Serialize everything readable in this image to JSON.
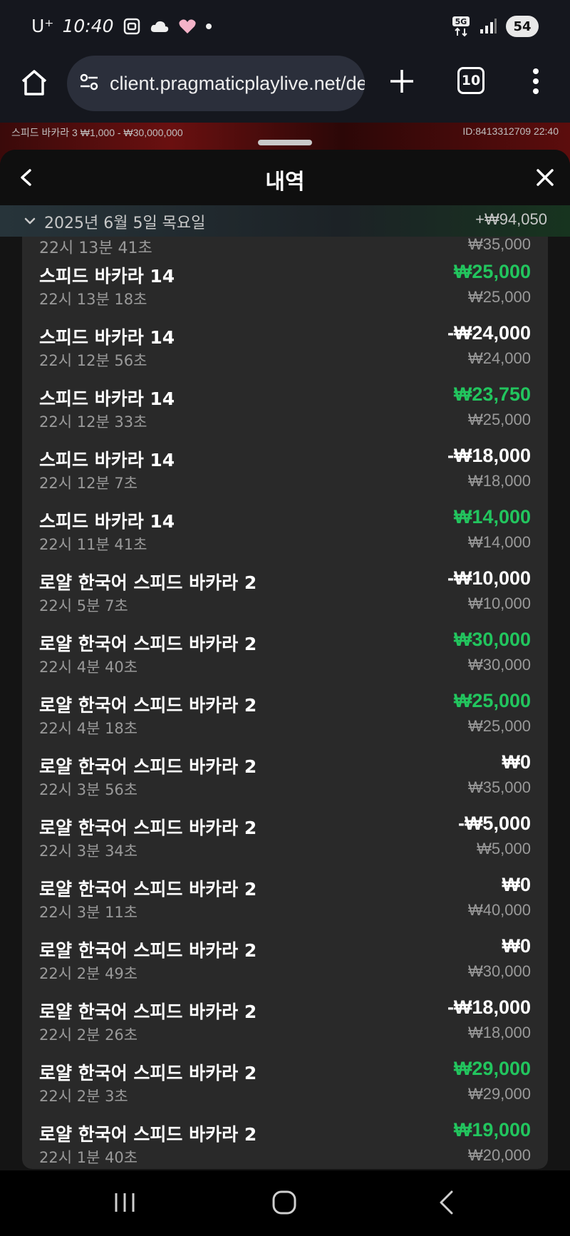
{
  "status_bar": {
    "carrier": "U⁺",
    "time": "10:40",
    "network": "5G",
    "battery": "54"
  },
  "browser": {
    "url": "client.pragmaticplaylive.net/de",
    "tab_count": "10"
  },
  "game_strip": {
    "table_info": "스피드 바카라 3  ₩1,000 - ₩30,000,000",
    "id_time": "ID:8413312709   22:40"
  },
  "sheet": {
    "title": "내역",
    "date_label": "2025년 6월 5일 목요일",
    "date_total": "+₩94,050",
    "partial_row": {
      "time": "22시 13분 41초",
      "bet": "₩35,000"
    },
    "rows": [
      {
        "name": "스피드 바카라 14",
        "time": "22시 13분 18초",
        "amount": "₩25,000",
        "result": "win",
        "bet": "₩25,000"
      },
      {
        "name": "스피드 바카라 14",
        "time": "22시 12분 56초",
        "amount": "-₩24,000",
        "result": "loss",
        "bet": "₩24,000"
      },
      {
        "name": "스피드 바카라 14",
        "time": "22시 12분 33초",
        "amount": "₩23,750",
        "result": "win",
        "bet": "₩25,000"
      },
      {
        "name": "스피드 바카라 14",
        "time": "22시 12분 7초",
        "amount": "-₩18,000",
        "result": "loss",
        "bet": "₩18,000"
      },
      {
        "name": "스피드 바카라 14",
        "time": "22시 11분 41초",
        "amount": "₩14,000",
        "result": "win",
        "bet": "₩14,000"
      },
      {
        "name": "로얄 한국어 스피드 바카라 2",
        "time": "22시 5분 7초",
        "amount": "-₩10,000",
        "result": "loss",
        "bet": "₩10,000"
      },
      {
        "name": "로얄 한국어 스피드 바카라 2",
        "time": "22시 4분 40초",
        "amount": "₩30,000",
        "result": "win",
        "bet": "₩30,000"
      },
      {
        "name": "로얄 한국어 스피드 바카라 2",
        "time": "22시 4분 18초",
        "amount": "₩25,000",
        "result": "win",
        "bet": "₩25,000"
      },
      {
        "name": "로얄 한국어 스피드 바카라 2",
        "time": "22시 3분 56초",
        "amount": "₩0",
        "result": "neutral",
        "bet": "₩35,000"
      },
      {
        "name": "로얄 한국어 스피드 바카라 2",
        "time": "22시 3분 34초",
        "amount": "-₩5,000",
        "result": "loss",
        "bet": "₩5,000"
      },
      {
        "name": "로얄 한국어 스피드 바카라 2",
        "time": "22시 3분 11초",
        "amount": "₩0",
        "result": "neutral",
        "bet": "₩40,000"
      },
      {
        "name": "로얄 한국어 스피드 바카라 2",
        "time": "22시 2분 49초",
        "amount": "₩0",
        "result": "neutral",
        "bet": "₩30,000"
      },
      {
        "name": "로얄 한국어 스피드 바카라 2",
        "time": "22시 2분 26초",
        "amount": "-₩18,000",
        "result": "loss",
        "bet": "₩18,000"
      },
      {
        "name": "로얄 한국어 스피드 바카라 2",
        "time": "22시 2분 3초",
        "amount": "₩29,000",
        "result": "win",
        "bet": "₩29,000"
      },
      {
        "name": "로얄 한국어 스피드 바카라 2",
        "time": "22시 1분 40초",
        "amount": "₩19,000",
        "result": "win",
        "bet": "₩20,000"
      }
    ]
  },
  "colors": {
    "win": "#22c55e",
    "loss": "#ffffff",
    "card_bg": "#292929"
  },
  "icons": {
    "home": "home-icon",
    "site_settings": "tune-icon",
    "new_tab": "plus-icon",
    "tabs": "tab-switcher-icon",
    "menu": "more-vert-icon",
    "back": "chevron-left-icon",
    "close": "close-icon",
    "collapse": "chevron-down-icon"
  }
}
